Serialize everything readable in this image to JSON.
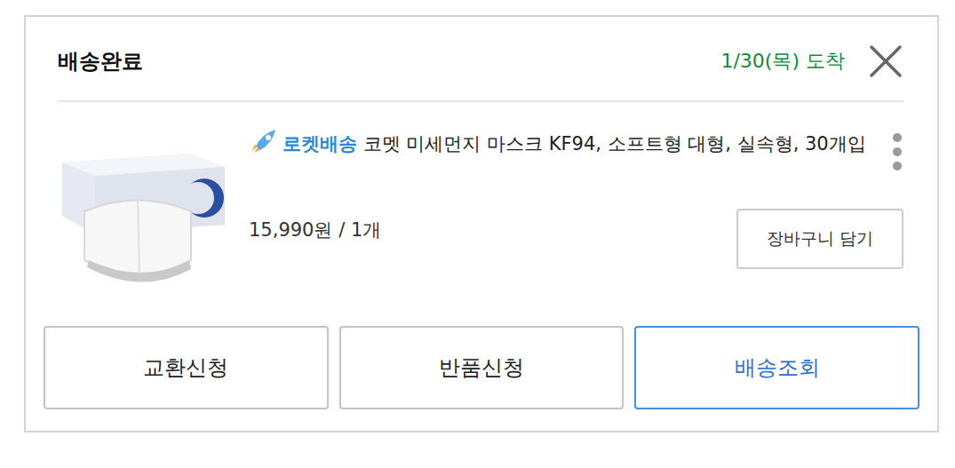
{
  "order": {
    "status": "배송완료",
    "arrival": "1/30(목) 도착"
  },
  "product": {
    "badge": "로켓배송",
    "name": "코멧 미세먼지 마스크 KF94, 소프트형 대형, 실속형, 30개입",
    "price": "15,990원 / 1개",
    "cart_button": "장바구니 담기"
  },
  "actions": [
    {
      "label": "교환신청",
      "highlighted": false
    },
    {
      "label": "반품신청",
      "highlighted": false
    },
    {
      "label": "배송조회",
      "highlighted": true
    }
  ]
}
